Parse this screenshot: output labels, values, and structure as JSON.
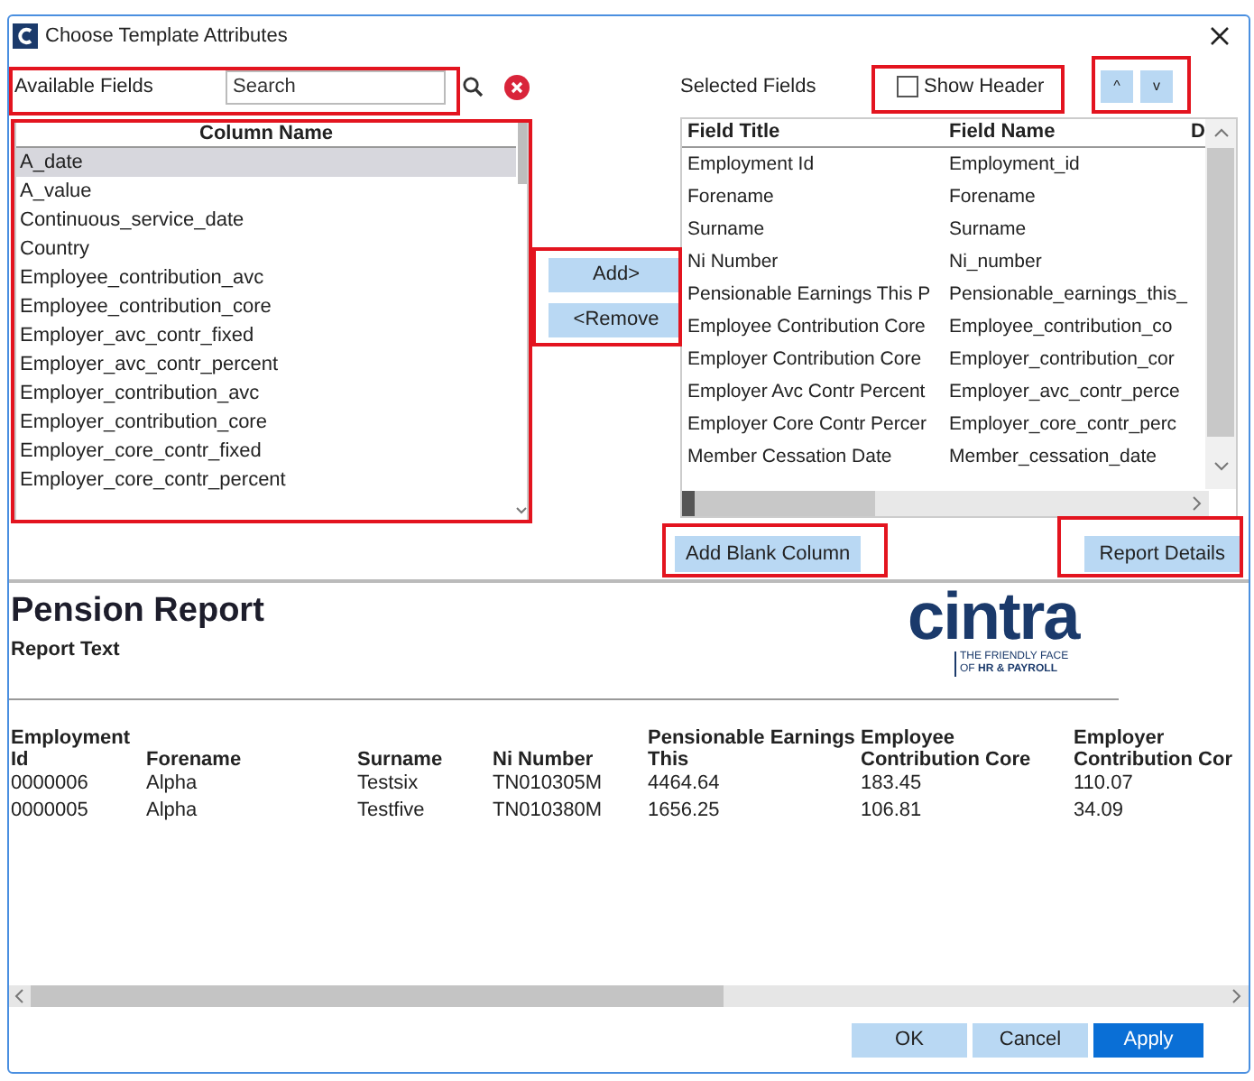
{
  "window": {
    "title": "Choose Template Attributes"
  },
  "available_fields": {
    "label": "Available Fields",
    "search": {
      "placeholder": "Search"
    },
    "column_header": "Column Name",
    "items": [
      {
        "text": "A_date",
        "selected": true
      },
      {
        "text": "A_value",
        "selected": false
      },
      {
        "text": "Continuous_service_date",
        "selected": false
      },
      {
        "text": "Country",
        "selected": false
      },
      {
        "text": "Employee_contribution_avc",
        "selected": false
      },
      {
        "text": "Employee_contribution_core",
        "selected": false
      },
      {
        "text": "Employer_avc_contr_fixed",
        "selected": false
      },
      {
        "text": "Employer_avc_contr_percent",
        "selected": false
      },
      {
        "text": "Employer_contribution_avc",
        "selected": false
      },
      {
        "text": "Employer_contribution_core",
        "selected": false
      },
      {
        "text": "Employer_core_contr_fixed",
        "selected": false
      },
      {
        "text": "Employer_core_contr_percent",
        "selected": false
      }
    ]
  },
  "move_buttons": [
    "Add>",
    "<Remove"
  ],
  "selected_fields": {
    "label": "Selected Fields",
    "show_header": {
      "label": "Show Header",
      "checked": false
    },
    "order_buttons": [
      "^",
      "v"
    ],
    "columns": [
      "Field Title",
      "Field Name",
      "D"
    ],
    "rows": [
      [
        "Employment Id",
        "Employment_id"
      ],
      [
        "Forename",
        "Forename"
      ],
      [
        "Surname",
        "Surname"
      ],
      [
        "Ni Number",
        "Ni_number"
      ],
      [
        "Pensionable Earnings This P",
        "Pensionable_earnings_this_"
      ],
      [
        "Employee Contribution Core",
        "Employee_contribution_co"
      ],
      [
        "Employer Contribution Core",
        "Employer_contribution_cor"
      ],
      [
        "Employer Avc Contr Percent",
        "Employer_avc_contr_perce"
      ],
      [
        "Employer Core Contr Percer",
        "Employer_core_contr_perc"
      ],
      [
        "Member Cessation Date",
        "Member_cessation_date"
      ]
    ]
  },
  "add_blank_column": "Add Blank Column",
  "report_details": "Report Details",
  "preview": {
    "title": "Pension Report",
    "subtitle": "Report Text",
    "logo": {
      "wordmark": "cintra",
      "tagline_1": "THE FRIENDLY FACE",
      "tagline_2": "OF **HR & PAYROLL**"
    },
    "columns": [
      "Employment Id",
      "Forename",
      "Surname",
      "Ni Number",
      "Pensionable Earnings This",
      "Employee Contribution Core",
      "Employer Contribution Cor"
    ],
    "rows": [
      [
        "0000006",
        "Alpha",
        "Testsix",
        "TN010305M",
        "4464.64",
        "183.45",
        "110.07"
      ],
      [
        "0000005",
        "Alpha",
        "Testfive",
        "TN010380M",
        "1656.25",
        "106.81",
        "34.09"
      ]
    ]
  },
  "footer_buttons": [
    {
      "label": "OK",
      "kind": "secondary"
    },
    {
      "label": "Cancel",
      "kind": "secondary"
    },
    {
      "label": "Apply",
      "kind": "primary"
    }
  ]
}
